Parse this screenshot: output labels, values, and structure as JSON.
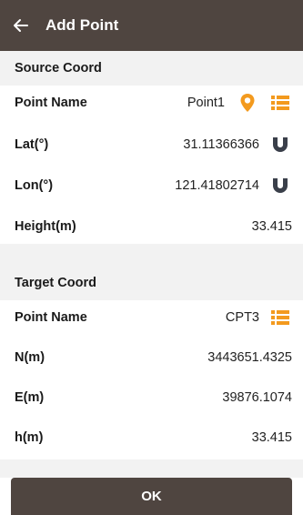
{
  "appbar": {
    "title": "Add Point",
    "back_icon": "arrow-left-icon"
  },
  "source": {
    "header": "Source Coord",
    "point_name_label": "Point Name",
    "point_name_value": "Point1",
    "lat_label": "Lat(°)",
    "lat_value": "31.11366366",
    "lon_label": "Lon(°)",
    "lon_value": "121.41802714",
    "height_label": "Height(m)",
    "height_value": "33.415"
  },
  "target": {
    "header": "Target Coord",
    "point_name_label": "Point Name",
    "point_name_value": "CPT3",
    "n_label": "N(m)",
    "n_value": "3443651.4325",
    "e_label": "E(m)",
    "e_value": "39876.1074",
    "h_label": "h(m)",
    "h_value": "33.415"
  },
  "footer": {
    "ok_label": "OK"
  },
  "colors": {
    "appbar": "#4f4540",
    "accent_orange": "#f39a1e",
    "section_bg": "#f2f2f2",
    "magnet_icon": "#3a3f4a"
  }
}
